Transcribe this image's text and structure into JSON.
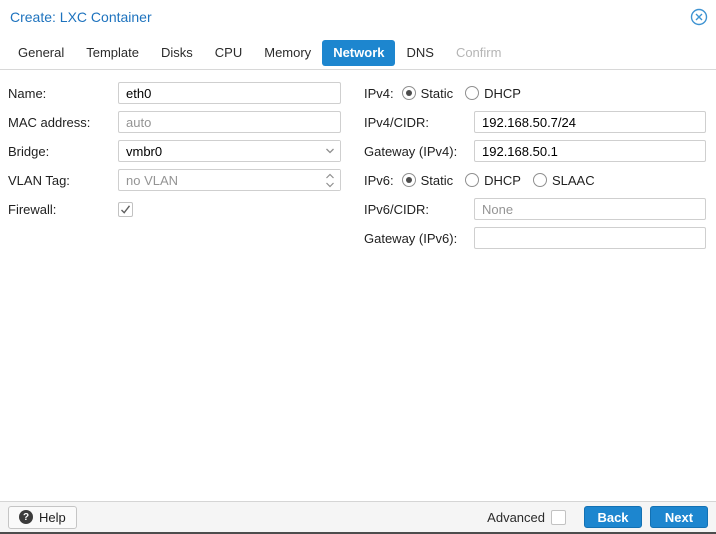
{
  "window": {
    "title": "Create: LXC Container"
  },
  "tabs": [
    {
      "label": "General",
      "state": "normal"
    },
    {
      "label": "Template",
      "state": "normal"
    },
    {
      "label": "Disks",
      "state": "normal"
    },
    {
      "label": "CPU",
      "state": "normal"
    },
    {
      "label": "Memory",
      "state": "normal"
    },
    {
      "label": "Network",
      "state": "active"
    },
    {
      "label": "DNS",
      "state": "normal"
    },
    {
      "label": "Confirm",
      "state": "disabled"
    }
  ],
  "form": {
    "left": {
      "name": {
        "label": "Name:",
        "value": "eth0"
      },
      "mac": {
        "label": "MAC address:",
        "placeholder": "auto"
      },
      "bridge": {
        "label": "Bridge:",
        "value": "vmbr0"
      },
      "vlan": {
        "label": "VLAN Tag:",
        "placeholder": "no VLAN"
      },
      "firewall": {
        "label": "Firewall:",
        "checked": true
      }
    },
    "right": {
      "ipv4_mode": {
        "label": "IPv4:",
        "options": [
          {
            "label": "Static",
            "selected": true
          },
          {
            "label": "DHCP",
            "selected": false
          }
        ]
      },
      "ipv4_cidr": {
        "label": "IPv4/CIDR:",
        "value": "192.168.50.7/24"
      },
      "gw4": {
        "label": "Gateway (IPv4):",
        "value": "192.168.50.1"
      },
      "ipv6_mode": {
        "label": "IPv6:",
        "options": [
          {
            "label": "Static",
            "selected": true
          },
          {
            "label": "DHCP",
            "selected": false
          },
          {
            "label": "SLAAC",
            "selected": false
          }
        ]
      },
      "ipv6_cidr": {
        "label": "IPv6/CIDR:",
        "placeholder": "None"
      },
      "gw6": {
        "label": "Gateway (IPv6):",
        "value": ""
      }
    }
  },
  "footer": {
    "help": "Help",
    "help_icon_glyph": "?",
    "advanced": "Advanced",
    "back": "Back",
    "next": "Next"
  },
  "colors": {
    "accent": "#1d86cf",
    "title_blue": "#1e73be"
  }
}
